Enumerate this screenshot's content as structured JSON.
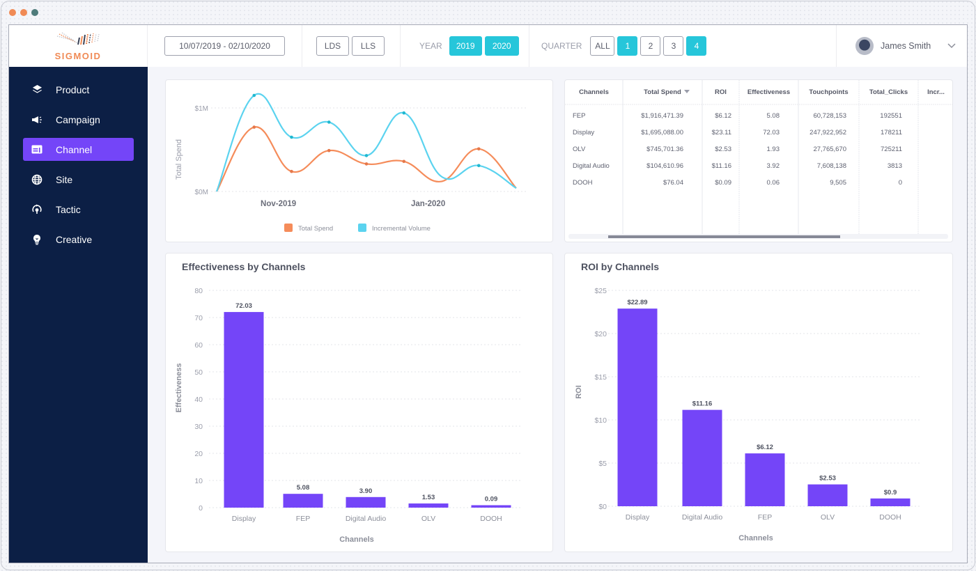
{
  "window": {
    "traffic_lights": [
      "#f08a55",
      "#f08a55",
      "#4d7a7a"
    ]
  },
  "header": {
    "logo_text": "SIGMOID",
    "date_range": "10/07/2019 - 02/10/2020",
    "segments": [
      {
        "label": "LDS",
        "active": false
      },
      {
        "label": "LLS",
        "active": false
      }
    ],
    "year_label": "YEAR",
    "years": [
      {
        "label": "2019",
        "active": true
      },
      {
        "label": "2020",
        "active": true
      }
    ],
    "quarter_label": "QUARTER",
    "quarters": [
      {
        "label": "ALL",
        "active": false
      },
      {
        "label": "1",
        "active": true
      },
      {
        "label": "2",
        "active": false
      },
      {
        "label": "3",
        "active": false
      },
      {
        "label": "4",
        "active": true
      }
    ],
    "user_name": "James Smith",
    "user_menu_icon": "chevron-down-icon"
  },
  "sidebar": {
    "items": [
      {
        "label": "Product",
        "icon": "layers-icon",
        "active": false
      },
      {
        "label": "Campaign",
        "icon": "megaphone-icon",
        "active": false
      },
      {
        "label": "Channel",
        "icon": "channel-icon",
        "active": true
      },
      {
        "label": "Site",
        "icon": "globe-icon",
        "active": false
      },
      {
        "label": "Tactic",
        "icon": "tactic-icon",
        "active": false
      },
      {
        "label": "Creative",
        "icon": "lightbulb-icon",
        "active": false
      }
    ]
  },
  "colors": {
    "accent": "#7445f8",
    "teal": "#26c6da",
    "orange": "#f58c5a",
    "cyan": "#5bd3ef",
    "sidebar": "#0c1f45"
  },
  "table": {
    "columns": [
      "Channels",
      "Total Spend",
      "ROI",
      "Effectiveness",
      "Touchpoints",
      "Total_Clicks",
      "Incr..."
    ],
    "sort_column": "Total Spend",
    "sort_icon": "sort-desc-icon",
    "rows": [
      [
        "FEP",
        "$1,916,471.39",
        "$6.12",
        "5.08",
        "60,728,153",
        "192551",
        ""
      ],
      [
        "Display",
        "$1,695,088.00",
        "$23.11",
        "72.03",
        "247,922,952",
        "178211",
        ""
      ],
      [
        "OLV",
        "$745,701.36",
        "$2.53",
        "1.93",
        "27,765,670",
        "725211",
        ""
      ],
      [
        "Digital Audio",
        "$104,610.96",
        "$11.16",
        "3.92",
        "7,608,138",
        "3813",
        ""
      ],
      [
        "DOOH",
        "$76.04",
        "$0.09",
        "0.06",
        "9,505",
        "0",
        ""
      ]
    ]
  },
  "chart_data": [
    {
      "type": "line",
      "title": "",
      "ylabel": "Total Spend",
      "xlabel": "",
      "y_ticks": [
        "$0M",
        "$1M"
      ],
      "ylim": [
        0,
        1.0
      ],
      "x_tick_labels": [
        {
          "label": "Nov-2019",
          "index": 1.5
        },
        {
          "label": "Jan-2020",
          "index": 5.5
        }
      ],
      "x": [
        0,
        1,
        2,
        3,
        4,
        5,
        6,
        7,
        8
      ],
      "series": [
        {
          "name": "Total Spend",
          "color": "#f58c5a",
          "values": [
            0.0,
            0.77,
            0.24,
            0.49,
            0.33,
            0.36,
            0.12,
            0.51,
            0.04
          ]
        },
        {
          "name": "Incremental Volume",
          "color": "#5bd3ef",
          "values": [
            0.0,
            1.15,
            0.65,
            0.83,
            0.43,
            0.94,
            0.18,
            0.31,
            0.04
          ]
        }
      ],
      "markers": [
        {
          "series": 0,
          "points": [
            1,
            2,
            3,
            4,
            5,
            7
          ]
        },
        {
          "series": 1,
          "points": [
            1,
            2,
            3,
            4,
            5,
            7
          ]
        }
      ],
      "legend": [
        "Total Spend",
        "Incremental Volume"
      ],
      "legend_position": "bottom",
      "grid": true
    },
    {
      "type": "bar",
      "title": "Effectiveness by Channels",
      "xlabel": "Channels",
      "ylabel": "Effectiveness",
      "categories": [
        "Display",
        "FEP",
        "Digital Audio",
        "OLV",
        "DOOH"
      ],
      "values": [
        72.03,
        5.08,
        3.9,
        1.53,
        0.09
      ],
      "data_labels": [
        "72.03",
        "5.08",
        "3.90",
        "1.53",
        "0.09"
      ],
      "y_ticks": [
        "0",
        "10",
        "20",
        "30",
        "40",
        "50",
        "60",
        "70",
        "80"
      ],
      "ylim": [
        0,
        80
      ],
      "color": "#7445f8",
      "grid": true
    },
    {
      "type": "bar",
      "title": "ROI by Channels",
      "xlabel": "Channels",
      "ylabel": "ROI",
      "categories": [
        "Display",
        "Digital Audio",
        "FEP",
        "OLV",
        "DOOH"
      ],
      "values": [
        22.89,
        11.16,
        6.12,
        2.53,
        0.9
      ],
      "data_labels": [
        "$22.89",
        "$11.16",
        "$6.12",
        "$2.53",
        "$0.9"
      ],
      "y_ticks": [
        "$0",
        "$5",
        "$10",
        "$15",
        "$20",
        "$25"
      ],
      "ylim": [
        0,
        25
      ],
      "color": "#7445f8",
      "grid": true
    }
  ]
}
